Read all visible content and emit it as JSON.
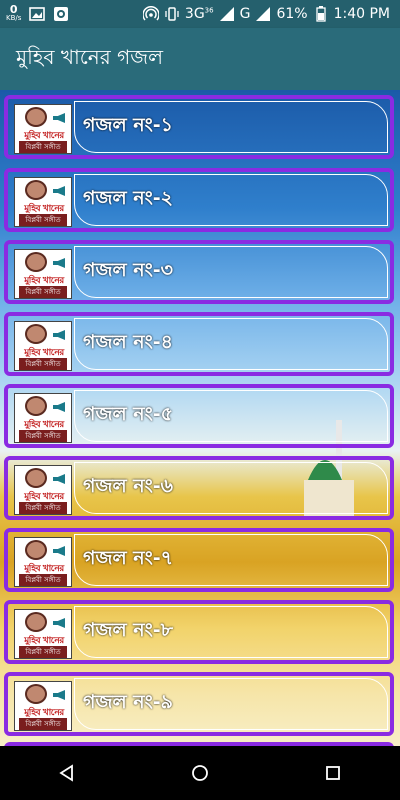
{
  "status_bar": {
    "speed_value": "0",
    "speed_unit": "KB/s",
    "network": "3G",
    "network_sup": "36",
    "carrier": "G",
    "battery": "61%",
    "time": "1:40 PM"
  },
  "app_bar": {
    "title": "মুহিব খানের গজল"
  },
  "thumbnail": {
    "title": "মুহিব খানের",
    "subtitle": "বিপ্লবী সঙ্গীত"
  },
  "list": {
    "items": [
      {
        "label": "গজল নং-১"
      },
      {
        "label": "গজল নং-২"
      },
      {
        "label": "গজল নং-৩"
      },
      {
        "label": "গজল নং-৪"
      },
      {
        "label": "গজল নং-৫"
      },
      {
        "label": "গজল নং-৬"
      },
      {
        "label": "গজল নং-৭"
      },
      {
        "label": "গজল নং-৮"
      },
      {
        "label": "গজল নং-৯"
      }
    ]
  },
  "colors": {
    "status_bar": "#25606d",
    "app_bar": "#2a6b7a",
    "item_border": "#8a2be2"
  }
}
